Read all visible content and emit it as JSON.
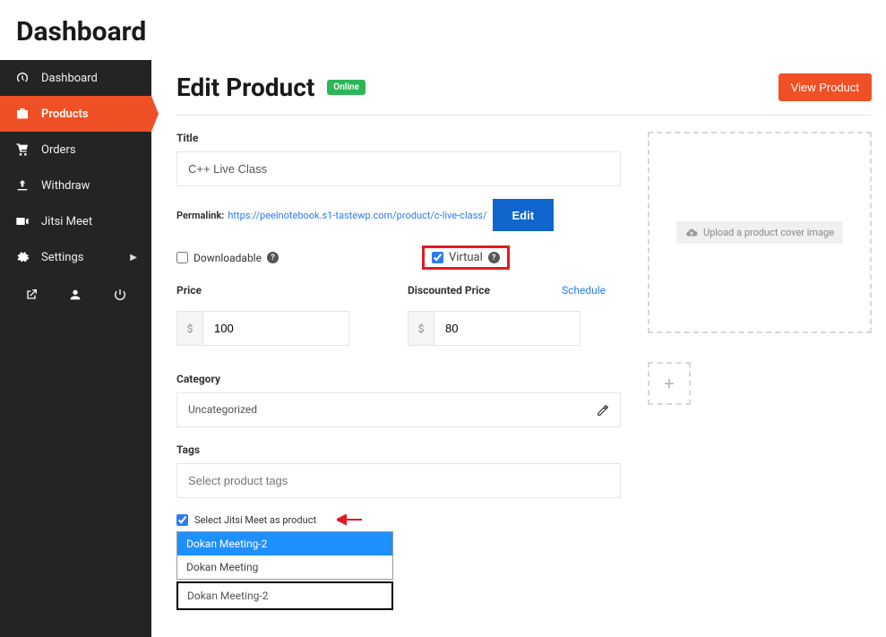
{
  "header": {
    "title": "Dashboard"
  },
  "sidebar": {
    "items": [
      {
        "label": "Dashboard"
      },
      {
        "label": "Products"
      },
      {
        "label": "Orders"
      },
      {
        "label": "Withdraw"
      },
      {
        "label": "Jitsi Meet"
      },
      {
        "label": "Settings"
      }
    ]
  },
  "page": {
    "title": "Edit Product",
    "status_badge": "Online",
    "view_button": "View Product"
  },
  "form": {
    "title_label": "Title",
    "title_value": "C++ Live Class",
    "permalink_label": "Permalink:",
    "permalink_url": "https://peelnotebook.s1-tastewp.com/product/c-live-class/",
    "edit_button": "Edit",
    "downloadable_label": "Downloadable",
    "virtual_label": "Virtual",
    "price_label": "Price",
    "price_value": "100",
    "discounted_label": "Discounted Price",
    "discounted_value": "80",
    "schedule_link": "Schedule",
    "currency_symbol": "$",
    "category_label": "Category",
    "category_value": "Uncategorized",
    "tags_label": "Tags",
    "tags_placeholder": "Select product tags",
    "jitsi_check_label": "Select Jitsi Meet as product",
    "jitsi_options": [
      "Dokan Meeting-2",
      "Dokan Meeting"
    ],
    "jitsi_selected_display": "Dokan Meeting-2"
  },
  "media": {
    "upload_label": "Upload a product cover image"
  }
}
